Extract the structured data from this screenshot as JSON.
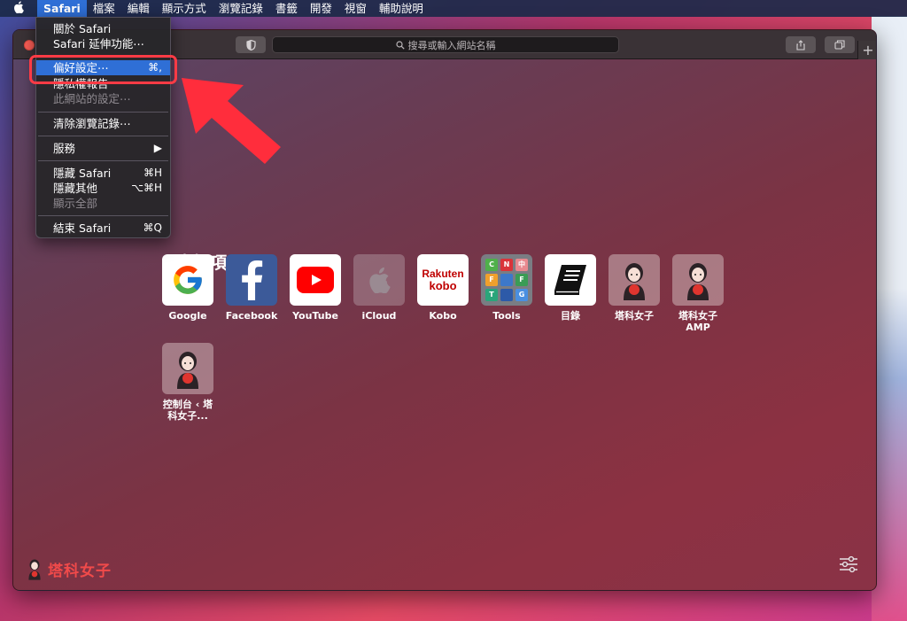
{
  "menubar": {
    "items": [
      "Safari",
      "檔案",
      "編輯",
      "顯示方式",
      "瀏覽記錄",
      "書籤",
      "開發",
      "視窗",
      "輔助說明"
    ],
    "active_index": 0
  },
  "safari_menu": {
    "items": [
      {
        "label": "關於 Safari",
        "shortcut": "",
        "disabled": false,
        "highlighted": false
      },
      {
        "label": "Safari 延伸功能⋯",
        "shortcut": "",
        "disabled": false,
        "highlighted": false
      },
      {
        "label": "偏好設定⋯",
        "shortcut": "⌘,",
        "disabled": false,
        "highlighted": true
      },
      {
        "label": "隱私權報告",
        "shortcut": "",
        "disabled": false,
        "highlighted": false
      },
      {
        "label": "此網站的設定⋯",
        "shortcut": "",
        "disabled": true,
        "highlighted": false
      },
      {
        "label": "清除瀏覽記錄⋯",
        "shortcut": "",
        "disabled": false,
        "highlighted": false
      },
      {
        "label": "服務",
        "shortcut": "▶",
        "disabled": false,
        "highlighted": false
      },
      {
        "label": "隱藏 Safari",
        "shortcut": "⌘H",
        "disabled": false,
        "highlighted": false
      },
      {
        "label": "隱藏其他",
        "shortcut": "⌥⌘H",
        "disabled": false,
        "highlighted": false
      },
      {
        "label": "顯示全部",
        "shortcut": "",
        "disabled": true,
        "highlighted": false
      },
      {
        "label": "結束 Safari",
        "shortcut": "⌘Q",
        "disabled": false,
        "highlighted": false
      }
    ]
  },
  "toolbar": {
    "address_placeholder": "搜尋或輸入網站名稱",
    "new_tab": "+"
  },
  "favorites": {
    "title": "喜好項目",
    "items": [
      {
        "label": "Google",
        "icon": "google-icon"
      },
      {
        "label": "Facebook",
        "icon": "facebook-icon"
      },
      {
        "label": "YouTube",
        "icon": "youtube-icon"
      },
      {
        "label": "iCloud",
        "icon": "apple-icon"
      },
      {
        "label": "Kobo",
        "icon": "kobo-icon",
        "logo_text": [
          "Rakuten",
          "kobo"
        ]
      },
      {
        "label": "Tools",
        "icon": "tools-icon",
        "grid": [
          "C",
          "N",
          "中",
          "F",
          "",
          "F",
          "T",
          "",
          "G"
        ]
      },
      {
        "label": "目錄",
        "icon": "book-icon"
      },
      {
        "label": "塔科女子",
        "icon": "girl-avatar-icon"
      },
      {
        "label": "塔科女子 AMP",
        "icon": "girl-avatar-icon"
      },
      {
        "label": "控制台 ‹ 塔科女子...",
        "icon": "girl-avatar-icon"
      }
    ]
  },
  "brand": {
    "text": "塔科女子"
  },
  "colors": {
    "accent_blue": "#2f6fd6",
    "highlight_red": "#ff3b45",
    "brand_red": "#f14a4a"
  }
}
